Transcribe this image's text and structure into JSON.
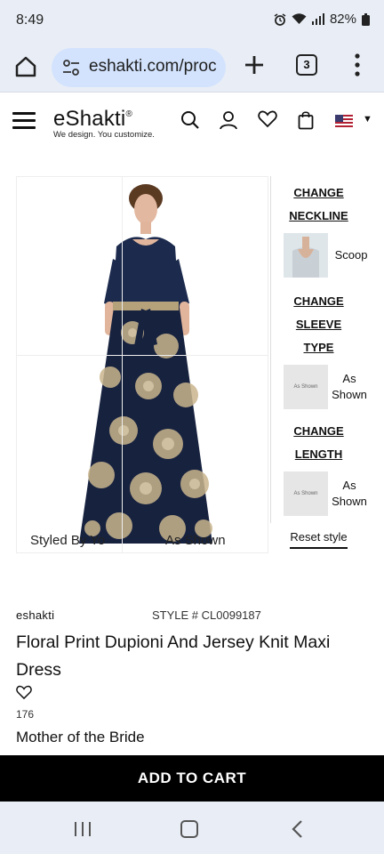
{
  "status_bar": {
    "time": "8:49",
    "battery": "82%",
    "icons": [
      "alarm-icon",
      "wifi-icon",
      "signal-icon",
      "battery-icon"
    ]
  },
  "browser": {
    "url": "eshakti.com/proc",
    "tab_count": "3",
    "icons": [
      "home-icon",
      "site-settings-icon",
      "new-tab-icon",
      "tabs-icon",
      "more-vert-icon"
    ]
  },
  "site_header": {
    "logo_text": "eShakti",
    "logo_mark": "®",
    "tagline": "We design. You customize.",
    "icons": [
      "menu-icon",
      "search-icon",
      "account-icon",
      "wishlist-icon",
      "cart-icon",
      "us-flag-icon",
      "caret-down-icon"
    ]
  },
  "product_image": {
    "styled_by_label": "Styled By Yo",
    "shown_label": "As Shown"
  },
  "customize": {
    "neckline_heading_1": "CHANGE",
    "neckline_heading_2": "NECKLINE",
    "neckline_value": "Scoop",
    "sleeve_heading_1": "CHANGE SLEEVE",
    "sleeve_heading_2": "TYPE",
    "sleeve_thumb": "As Shown",
    "sleeve_value_1": "As",
    "sleeve_value_2": "Shown",
    "length_heading": "CHANGE LENGTH",
    "length_thumb": "As Shown",
    "length_value_1": "As",
    "length_value_2": "Shown",
    "reset_label": "Reset style"
  },
  "product": {
    "brand": "eshakti",
    "style_number": "STYLE # CL0099187",
    "title": "Floral Print Dupioni And Jersey Knit Maxi Dress",
    "favorites_count": "176",
    "category": "Mother of the Bride"
  },
  "cta": {
    "add_to_cart": "ADD TO CART"
  },
  "colors": {
    "status_bg": "#e9eef6",
    "url_pill": "#d3e3fd",
    "cta_bg": "#000000",
    "dress_navy": "#1c2a4d",
    "floral_gold": "#c9b58d"
  }
}
